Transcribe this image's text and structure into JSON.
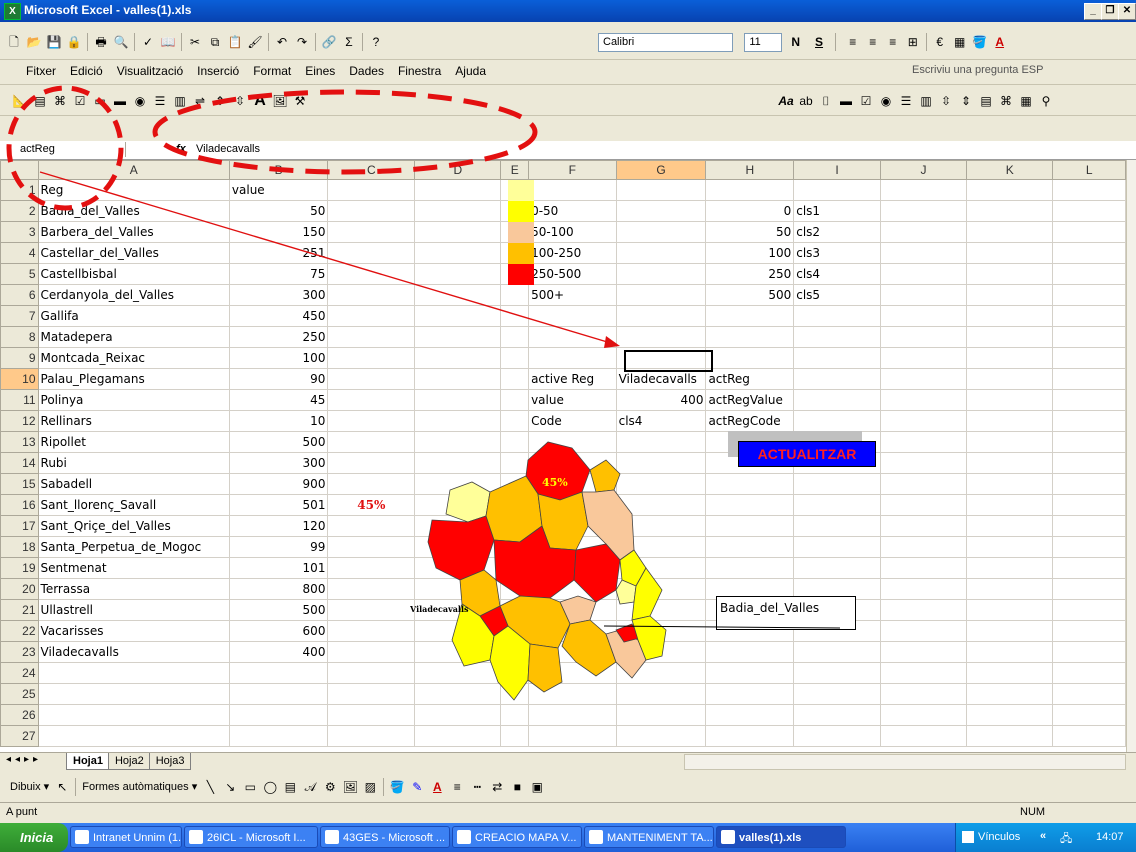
{
  "window": {
    "title": "Microsoft Excel - valles(1).xls",
    "app_icon": "excel-icon"
  },
  "toolbar": {
    "font": "Calibri",
    "size": "11",
    "bold": "N",
    "underline": "S"
  },
  "menu": {
    "items": [
      "Fitxer",
      "Edició",
      "Visualització",
      "Inserció",
      "Format",
      "Eines",
      "Dades",
      "Finestra",
      "Ajuda"
    ],
    "help_placeholder": "Escriviu una pregunta ESP"
  },
  "formula": {
    "name_box": "actReg",
    "fx": "fx",
    "content": "Viladecavalls"
  },
  "columns": [
    "A",
    "B",
    "C",
    "D",
    "E",
    "F",
    "G",
    "H",
    "I",
    "J",
    "K",
    "L"
  ],
  "rows": [
    {
      "n": "1",
      "a": "Reg",
      "b": "value"
    },
    {
      "n": "2",
      "a": "Badia_del_Valles",
      "b": "50",
      "f": "0-50",
      "h": "0",
      "i": "cls1"
    },
    {
      "n": "3",
      "a": "Barbera_del_Valles",
      "b": "150",
      "f": "50-100",
      "h": "50",
      "i": "cls2"
    },
    {
      "n": "4",
      "a": "Castellar_del_Valles",
      "b": "251",
      "f": "100-250",
      "h": "100",
      "i": "cls3"
    },
    {
      "n": "5",
      "a": "Castellbisbal",
      "b": "75",
      "f": "250-500",
      "h": "250",
      "i": "cls4"
    },
    {
      "n": "6",
      "a": "Cerdanyola_del_Valles",
      "b": "300",
      "f": "500+",
      "h": "500",
      "i": "cls5"
    },
    {
      "n": "7",
      "a": "Gallifa",
      "b": "450"
    },
    {
      "n": "8",
      "a": "Matadepera",
      "b": "250"
    },
    {
      "n": "9",
      "a": "Montcada_Reixac",
      "b": "100"
    },
    {
      "n": "10",
      "a": "Palau_Plegamans",
      "b": "90",
      "f": "active Reg",
      "g": "Viladecavalls",
      "h": "actReg"
    },
    {
      "n": "11",
      "a": "Polinya",
      "b": "45",
      "f": "value",
      "g": "400",
      "h": "actRegValue"
    },
    {
      "n": "12",
      "a": "Rellinars",
      "b": "10",
      "f": "Code",
      "g": "cls4",
      "h": "actRegCode"
    },
    {
      "n": "13",
      "a": "Ripollet",
      "b": "500"
    },
    {
      "n": "14",
      "a": "Rubi",
      "b": "300"
    },
    {
      "n": "15",
      "a": "Sabadell",
      "b": "900"
    },
    {
      "n": "16",
      "a": "Sant_llorenç_Savall",
      "b": "501",
      "c": "45%"
    },
    {
      "n": "17",
      "a": "Sant_Qriçe_del_Valles",
      "b": "120"
    },
    {
      "n": "18",
      "a": "Santa_Perpetua_de_Mogoc",
      "b": "99"
    },
    {
      "n": "19",
      "a": "Sentmenat",
      "b": "101"
    },
    {
      "n": "20",
      "a": "Terrassa",
      "b": "800"
    },
    {
      "n": "21",
      "a": "Ullastrell",
      "b": "500"
    },
    {
      "n": "22",
      "a": "Vacarisses",
      "b": "600"
    },
    {
      "n": "23",
      "a": "Viladecavalls",
      "b": "400"
    },
    {
      "n": "24"
    },
    {
      "n": "25"
    },
    {
      "n": "26"
    },
    {
      "n": "27"
    }
  ],
  "legend_colors": [
    "#ffff99",
    "#ffff00",
    "#f9c89b",
    "#ffc000",
    "#ff0000"
  ],
  "map": {
    "label_pct": "45%",
    "label_town": "Viladecavalls",
    "callout": "Badia_del_Valles"
  },
  "button": {
    "label": "ACTUALITZAR"
  },
  "sheets": [
    "Hoja1",
    "Hoja2",
    "Hoja3"
  ],
  "drawing": {
    "dibuix": "Dibuix",
    "shapes": "Formes autòmatiques"
  },
  "status": {
    "left": "A punt",
    "num": "NUM"
  },
  "taskbar": {
    "start": "Inicia",
    "tasks": [
      "Intranet Unnim (1...",
      "26ICL - Microsoft I...",
      "43GES - Microsoft ...",
      "CREACIO MAPA V...",
      "MANTENIMENT TA...",
      "valles(1).xls"
    ],
    "tray_label": "Vínculos",
    "clock": "14:07"
  }
}
